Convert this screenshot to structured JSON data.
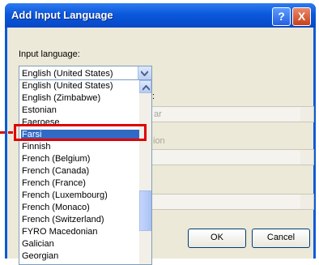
{
  "window": {
    "title": "Add Input Language"
  },
  "labels": {
    "input_language": "Input language:"
  },
  "input_language_combo": {
    "value": "English (United States)"
  },
  "right_fragments": {
    "colon_text": ":",
    "ar_text": "ar",
    "ion_text": "ion"
  },
  "dropdown_list": {
    "items": [
      "English (United States)",
      "English (Zimbabwe)",
      "Estonian",
      "Faeroese",
      "Farsi",
      "Finnish",
      "French (Belgium)",
      "French (Canada)",
      "French (France)",
      "French (Luxembourg)",
      "French (Monaco)",
      "French (Switzerland)",
      "FYRO Macedonian",
      "Galician",
      "Georgian"
    ],
    "selected_index": 4
  },
  "buttons": {
    "ok": "OK",
    "cancel": "Cancel",
    "help": "?",
    "close": "X"
  },
  "colors": {
    "selection": "#316ac5",
    "highlight_box": "#e00000"
  }
}
